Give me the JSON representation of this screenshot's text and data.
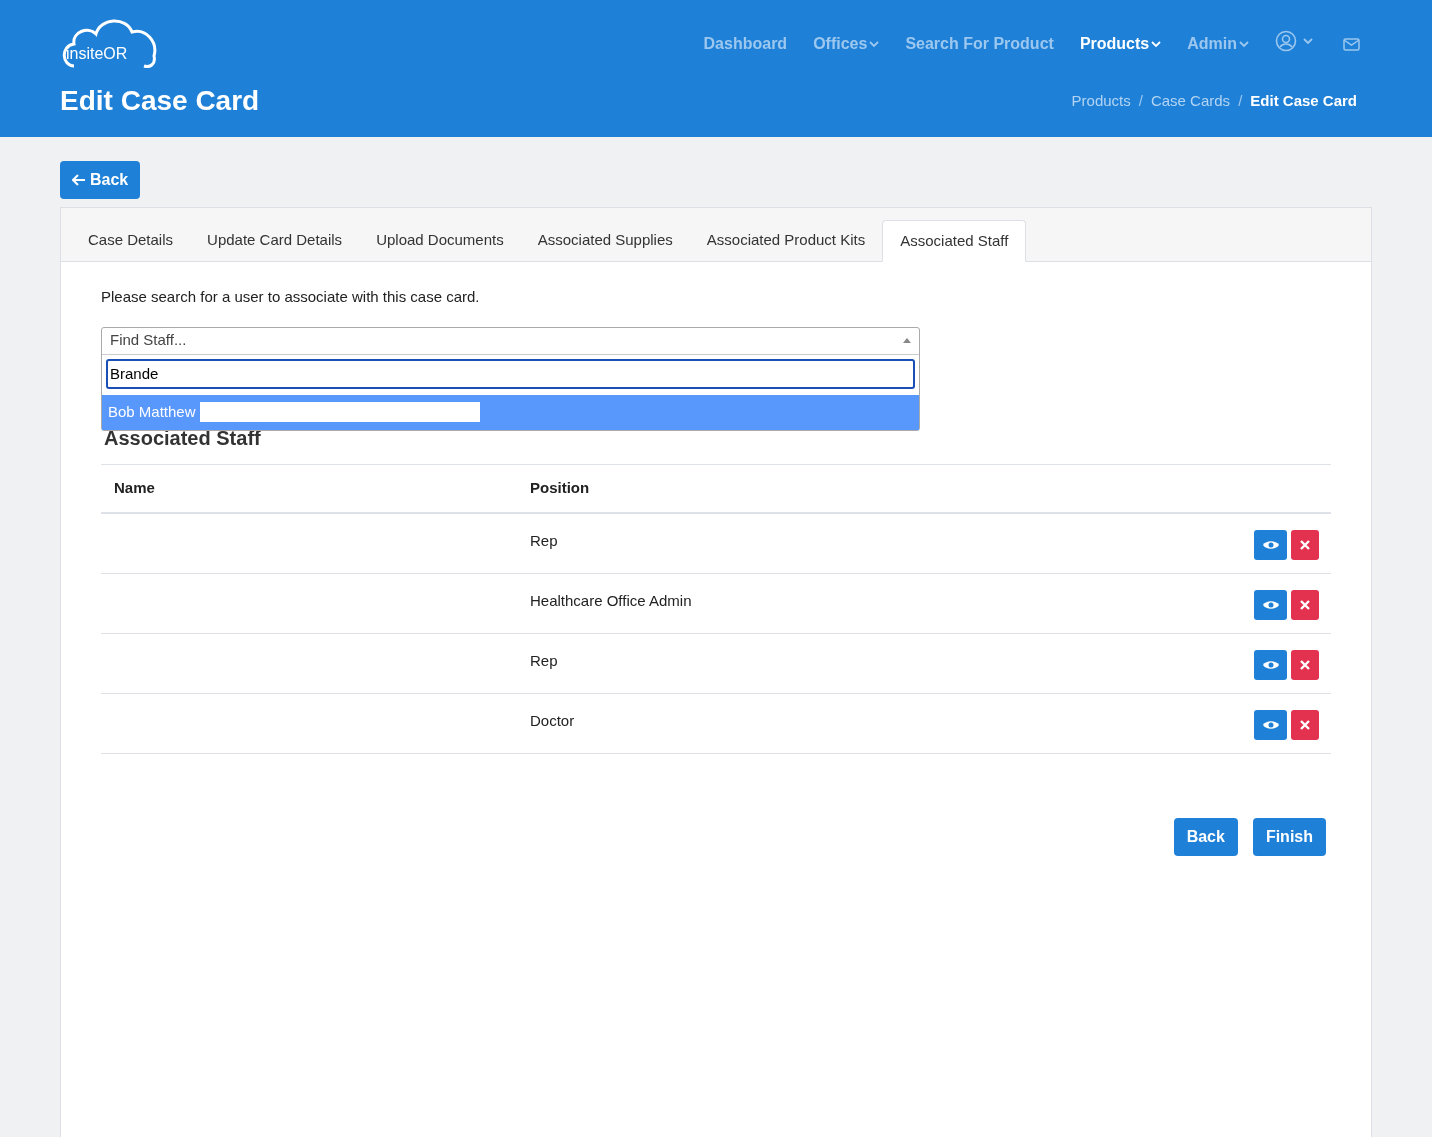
{
  "header": {
    "logo": "insiteOR",
    "title": "Edit Case Card",
    "nav": [
      {
        "label": "Dashboard",
        "selected": false,
        "dropdown": false
      },
      {
        "label": "Offices",
        "selected": false,
        "dropdown": true
      },
      {
        "label": "Search For Product",
        "selected": false,
        "dropdown": false
      },
      {
        "label": "Products",
        "selected": true,
        "dropdown": true
      },
      {
        "label": "Admin",
        "selected": false,
        "dropdown": true
      }
    ],
    "breadcrumbs": [
      {
        "label": "Products",
        "current": false
      },
      {
        "separator": "/",
        "label": "Case Cards",
        "current": false
      },
      {
        "separator": "/",
        "label": "Edit Case Card",
        "current": true
      }
    ]
  },
  "back_button": "Back",
  "tabs": [
    {
      "label": "Case Details",
      "selected": false
    },
    {
      "label": "Update Card Details",
      "selected": false
    },
    {
      "label": "Upload Documents",
      "selected": false
    },
    {
      "label": "Associated Supplies",
      "selected": false
    },
    {
      "label": "Associated Product Kits",
      "selected": false
    },
    {
      "label": "Associated Staff",
      "selected": true
    }
  ],
  "instruction": "Please search for a user to associate with this case card.",
  "staff_select": {
    "placeholder": "Find Staff...",
    "search_value": "Brande",
    "options": [
      {
        "label": "Bob Matthew",
        "selected": true
      }
    ]
  },
  "section_title": "Associated Staff",
  "table": {
    "columns": [
      "Name",
      "Position"
    ],
    "rows": [
      {
        "position": "Rep"
      },
      {
        "position": "Healthcare Office Admin"
      },
      {
        "position": "Rep"
      },
      {
        "position": "Doctor"
      }
    ]
  },
  "footer_buttons": [
    "Back",
    "Finish"
  ]
}
